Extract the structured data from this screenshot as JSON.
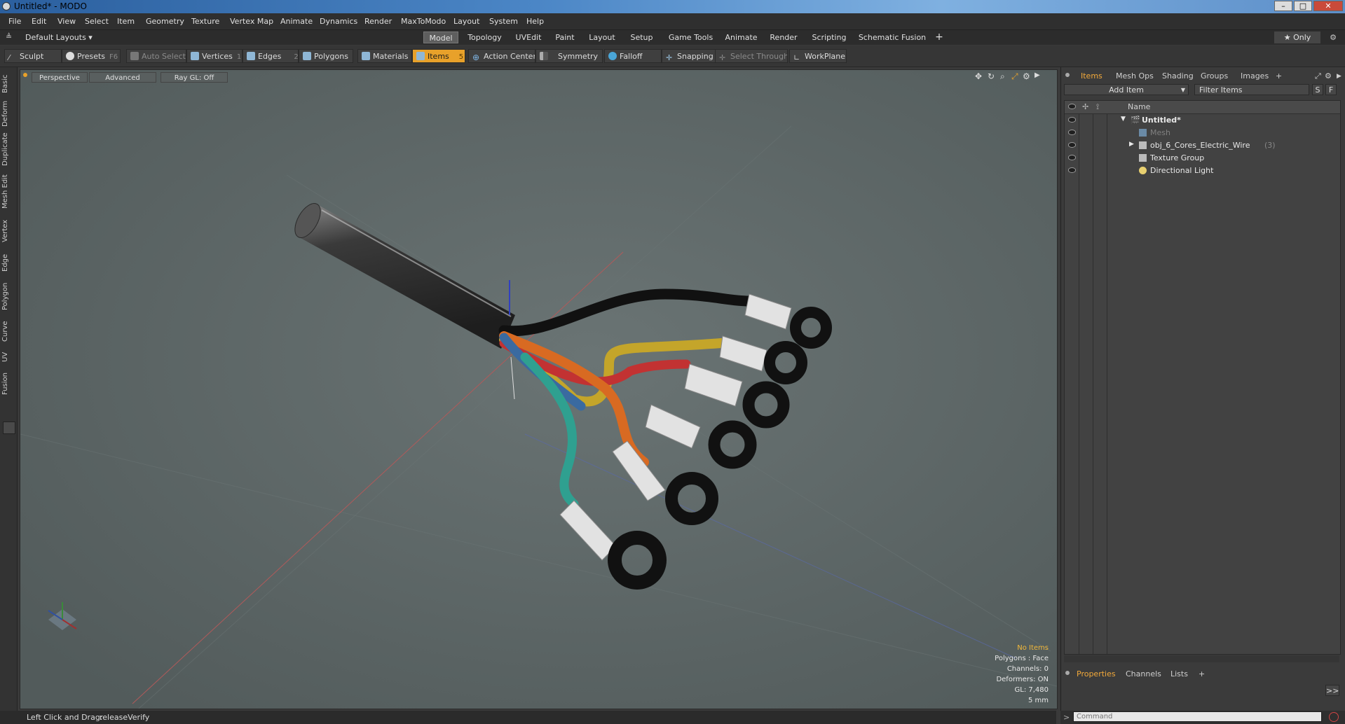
{
  "window": {
    "title": "Untitled* - MODO",
    "min": "–",
    "max": "□",
    "close": "✕"
  },
  "menu": [
    "File",
    "Edit",
    "View",
    "Select",
    "Item",
    "Geometry",
    "Texture",
    "Vertex Map",
    "Animate",
    "Dynamics",
    "Render",
    "MaxToModo",
    "Layout",
    "System",
    "Help"
  ],
  "layout_selector": "Default Layouts ▾",
  "layout_tabs": [
    "Model",
    "Topology",
    "UVEdit",
    "Paint",
    "Layout",
    "Setup",
    "Game Tools",
    "Animate",
    "Render",
    "Scripting",
    "Schematic Fusion"
  ],
  "layout_add": "+",
  "only_label": "★  Only",
  "toolbar": {
    "sculpt": "Sculpt",
    "presets": "Presets",
    "presets_key": "F6",
    "auto_select": "Auto Select",
    "vertices": "Vertices",
    "vertices_key": "1",
    "edges": "Edges",
    "edges_key": "2",
    "polygons": "Polygons",
    "materials": "Materials",
    "items": "Items",
    "items_key": "5",
    "action_center": "Action Center",
    "symmetry": "Symmetry",
    "falloff": "Falloff",
    "snapping": "Snapping",
    "select_through": "Select Through",
    "workplane": "WorkPlane"
  },
  "left_tabs": [
    "Basic",
    "Deform",
    "Duplicate",
    "Mesh Edit",
    "Vertex",
    "Edge",
    "Polygon",
    "Curve",
    "UV",
    "Fusion"
  ],
  "viewport": {
    "view": "Perspective",
    "mode": "Advanced",
    "raygl": "Ray GL: Off",
    "hud": {
      "items": "No Items",
      "polygons": "Polygons : Face",
      "channels": "Channels: 0",
      "deformers": "Deformers: ON",
      "gl": "GL: 7,480",
      "unit": "5 mm"
    }
  },
  "right_panel": {
    "tabs": [
      "Items",
      "Mesh Ops",
      "Shading",
      "Groups",
      "Images"
    ],
    "add_item": "Add Item",
    "filter": "Filter Items",
    "s_btn": "S",
    "f_btn": "F",
    "name_header": "Name",
    "tree": [
      {
        "label": "Untitled*",
        "count": ""
      },
      {
        "label": "Mesh",
        "count": ""
      },
      {
        "label": "obj_6_Cores_Electric_Wire",
        "count": "(3)"
      },
      {
        "label": "Texture Group",
        "count": ""
      },
      {
        "label": "Directional Light",
        "count": ""
      }
    ],
    "bottom_tabs": [
      "Properties",
      "Channels",
      "Lists"
    ],
    "expand": ">>"
  },
  "statusbar": {
    "hint": "Left Click and Drag:",
    "action": "releaseVerify"
  },
  "command": {
    "placeholder": "Command"
  }
}
